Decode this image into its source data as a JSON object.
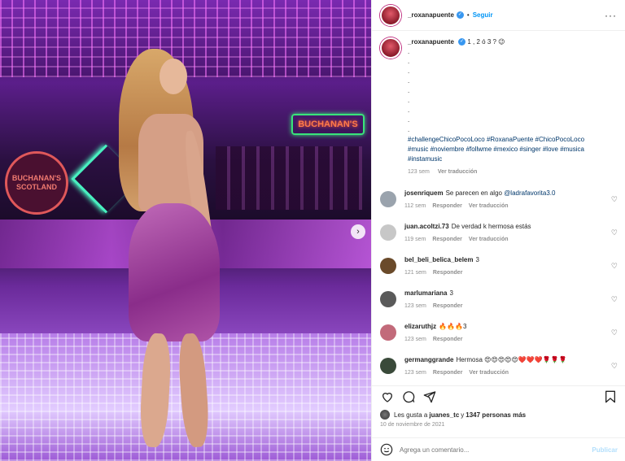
{
  "photo": {
    "logo_text": "BUCHANAN'S SCOTLAND",
    "neon_sign_text": "BUCHANAN'S",
    "next_icon": "chevron-right-icon"
  },
  "header": {
    "username": "_roxanapuente",
    "separator": "•",
    "follow_label": "Seguir",
    "more_label": "···"
  },
  "caption": {
    "username": "_roxanapuente",
    "text": "1 , 2 ó 3 ? 😉",
    "dots": [
      ".",
      ".",
      ".",
      ".",
      ".",
      ".",
      ".",
      ".",
      "."
    ],
    "hashtags": "#challengeChicoPocoLoco #RoxanaPuente #ChicoPocoLoco #music #noviembre #follwme #mexico #singer #love #musica #instamusic",
    "time": "123 sem",
    "translate": "Ver traducción"
  },
  "comments": [
    {
      "username": "josenriquem",
      "text": "Se parecen en algo ",
      "mention": "@ladrafavorita3.0",
      "time": "112 sem",
      "reply": "Responder",
      "translate": "Ver traducción",
      "avatar_color": "#9aa3ad"
    },
    {
      "username": "juan.acoltzi.73",
      "text": "De verdad k hermosa estás",
      "mention": "",
      "time": "119 sem",
      "reply": "Responder",
      "translate": "Ver traducción",
      "avatar_color": "#c7c7c7"
    },
    {
      "username": "bel_beli_belica_belem",
      "text": "3",
      "mention": "",
      "time": "121 sem",
      "reply": "Responder",
      "translate": "",
      "avatar_color": "#6a4a2a"
    },
    {
      "username": "marlumariana",
      "text": "3",
      "mention": "",
      "time": "123 sem",
      "reply": "Responder",
      "translate": "",
      "avatar_color": "#5a5a5a"
    },
    {
      "username": "elizaruthjz",
      "text": "🔥🔥🔥3",
      "mention": "",
      "time": "123 sem",
      "reply": "Responder",
      "translate": "",
      "avatar_color": "#c26a7a"
    },
    {
      "username": "germanggrande",
      "text": "Hermosa 😍😍😍😍😍❤️❤️❤️🌹🌹🌹",
      "mention": "",
      "time": "123 sem",
      "reply": "Responder",
      "translate": "Ver traducción",
      "avatar_color": "#3a4a3a"
    }
  ],
  "likes": {
    "prefix": "Les gusta a ",
    "user": "juanes_tc",
    "middle": " y ",
    "count": "1347 personas más"
  },
  "date": "10 de noviembre de 2021",
  "add_comment": {
    "placeholder": "Agrega un comentario...",
    "publish_label": "Publicar"
  },
  "colors": {
    "accent": "#0095f6",
    "link": "#00376b",
    "muted": "#8e8e8e"
  }
}
